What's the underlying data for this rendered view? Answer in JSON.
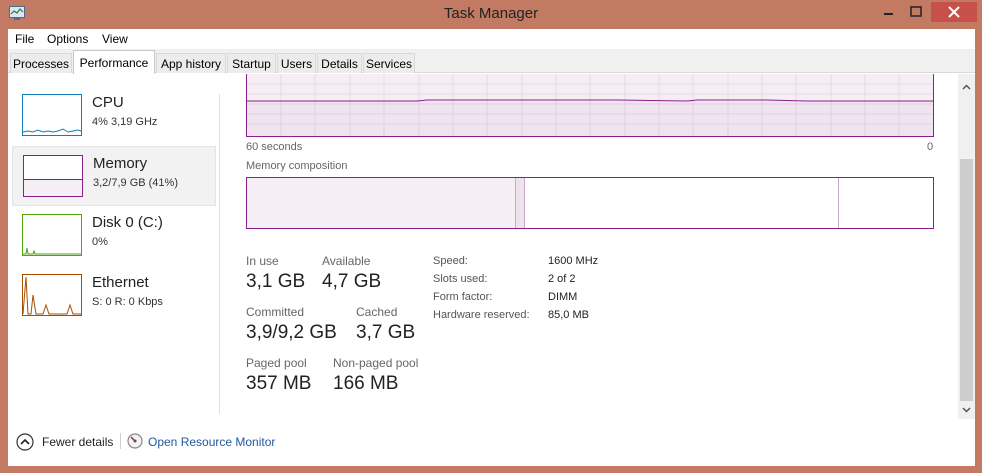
{
  "window": {
    "title": "Task Manager"
  },
  "menu": [
    "File",
    "Options",
    "View"
  ],
  "tabs": [
    "Processes",
    "Performance",
    "App history",
    "Startup",
    "Users",
    "Details",
    "Services"
  ],
  "sidebar": [
    {
      "title": "CPU",
      "sub": "4% 3,19 GHz",
      "color": "#117dbb"
    },
    {
      "title": "Memory",
      "sub": "3,2/7,9 GB (41%)",
      "color": "#8b1e8b"
    },
    {
      "title": "Disk 0 (C:)",
      "sub": "0%",
      "color": "#4da60c"
    },
    {
      "title": "Ethernet",
      "sub": "S: 0 R: 0 Kbps",
      "color": "#a74f01"
    }
  ],
  "graph": {
    "left_label": "60 seconds",
    "right_label": "0",
    "usage_fraction": 0.41
  },
  "composition": {
    "label": "Memory composition"
  },
  "stats": {
    "in_use_label": "In use",
    "in_use": "3,1 GB",
    "available_label": "Available",
    "available": "4,7 GB",
    "committed_label": "Committed",
    "committed": "3,9/9,2 GB",
    "cached_label": "Cached",
    "cached": "3,7 GB",
    "paged_label": "Paged pool",
    "paged": "357 MB",
    "nonpaged_label": "Non-paged pool",
    "nonpaged": "166 MB"
  },
  "details": [
    {
      "key": "Speed:",
      "value": "1600 MHz"
    },
    {
      "key": "Slots used:",
      "value": "2 of 2"
    },
    {
      "key": "Form factor:",
      "value": "DIMM"
    },
    {
      "key": "Hardware reserved:",
      "value": "85,0 MB"
    }
  ],
  "footer": {
    "fewer": "Fewer details",
    "monitor": "Open Resource Monitor"
  },
  "colors": {
    "memory": "#8b1e8b",
    "link": "#1e5aa0"
  }
}
